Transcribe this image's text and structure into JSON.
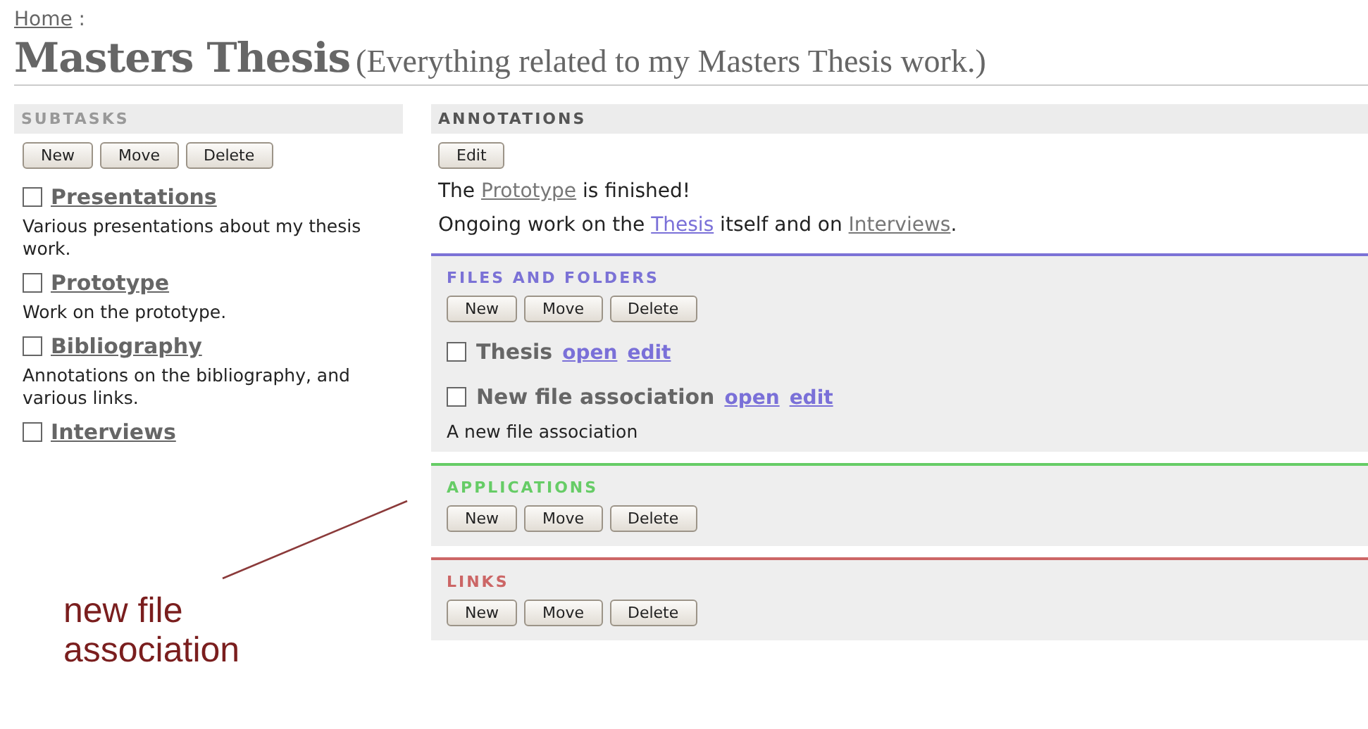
{
  "breadcrumb": {
    "link": "Home",
    "separator": ":"
  },
  "title": "Masters Thesis",
  "subtitle": "(Everything related to my Masters Thesis work.)",
  "subtasks": {
    "heading": "SUBTASKS",
    "buttons": [
      "New",
      "Move",
      "Delete"
    ],
    "items": [
      {
        "name": "Presentations",
        "checked": false,
        "description": "Various presentations about my thesis work."
      },
      {
        "name": "Prototype",
        "checked": false,
        "description": "Work on the prototype."
      },
      {
        "name": "Bibliography",
        "checked": false,
        "description": "Annotations on the bibliography, and various links."
      },
      {
        "name": "Interviews",
        "checked": false
      }
    ]
  },
  "annotations": {
    "heading": "ANNOTATIONS",
    "button": "Edit",
    "paragraphs": [
      [
        {
          "kind": "text",
          "text": "The "
        },
        {
          "kind": "link",
          "text": "Prototype",
          "visited": true
        },
        {
          "kind": "text",
          "text": " is finished!"
        }
      ],
      [
        {
          "kind": "text",
          "text": "Ongoing work on the "
        },
        {
          "kind": "link",
          "text": "Thesis",
          "visited": false
        },
        {
          "kind": "text",
          "text": " itself and on "
        },
        {
          "kind": "link",
          "text": "Interviews",
          "visited": true
        },
        {
          "kind": "text",
          "text": "."
        }
      ]
    ]
  },
  "sections": [
    {
      "heading": "FILES AND FOLDERS",
      "color": "#7b72d6",
      "buttons": [
        "New",
        "Move",
        "Delete"
      ],
      "items": [
        {
          "name": "Thesis",
          "checked": false,
          "links": [
            "open",
            "edit"
          ]
        },
        {
          "name": "New file association",
          "checked": false,
          "links": [
            "open",
            "edit"
          ],
          "description": "A new file association"
        }
      ]
    },
    {
      "heading": "APPLICATIONS",
      "color": "#66cc66",
      "buttons": [
        "New",
        "Move",
        "Delete"
      ]
    },
    {
      "heading": "LINKS",
      "color": "#cc6666",
      "buttons": [
        "New",
        "Move",
        "Delete"
      ]
    }
  ],
  "callout": {
    "text": "new file association"
  }
}
